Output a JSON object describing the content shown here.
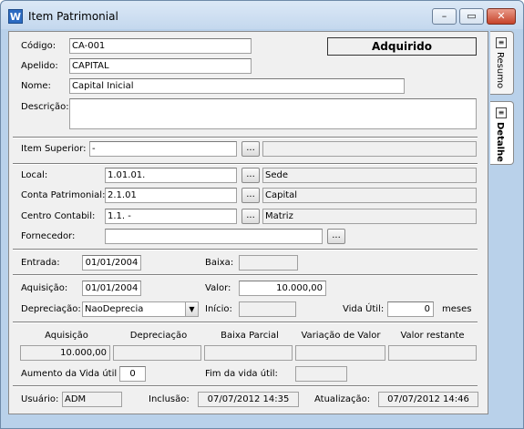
{
  "window": {
    "title": "Item Patrimonial",
    "app_icon": "W"
  },
  "status": "Adquirido",
  "tabs": [
    {
      "label": "Resumo"
    },
    {
      "label": "Detalhe"
    }
  ],
  "labels": {
    "codigo": "Código:",
    "apelido": "Apelido:",
    "nome": "Nome:",
    "descricao": "Descrição:",
    "item_superior": "Item Superior:",
    "local": "Local:",
    "conta": "Conta Patrimonial:",
    "centro": "Centro Contabil:",
    "fornecedor": "Fornecedor:",
    "entrada": "Entrada:",
    "baixa": "Baixa:",
    "aquisicao": "Aquisição:",
    "valor": "Valor:",
    "depreciacao": "Depreciação:",
    "inicio": "Início:",
    "vida_util": "Vida Útil:",
    "meses": "meses",
    "aumento": "Aumento da Vida útil :",
    "fim_vida": "Fim da vida útil:",
    "usuario": "Usuário:",
    "inclusao": "Inclusão:",
    "atualizacao": "Atualização:"
  },
  "fields": {
    "codigo": "CA-001",
    "apelido": "CAPITAL",
    "nome": "Capital Inicial",
    "descricao": "",
    "item_superior": "-",
    "item_superior_desc": "",
    "local": "1.01.01.",
    "local_desc": "Sede",
    "conta": "2.1.01",
    "conta_desc": "Capital",
    "centro": "1.1.  -",
    "centro_desc": "Matriz",
    "fornecedor": "",
    "fornecedor_desc": "",
    "entrada": "01/01/2004",
    "baixa": "",
    "aquisicao": "01/01/2004",
    "valor": "10.000,00",
    "depreciacao": "NaoDeprecia",
    "inicio": "",
    "vida_util": "0",
    "aumento": "0",
    "fim_vida": "",
    "usuario": "ADM",
    "inclusao": "07/07/2012 14:35",
    "atualizacao": "07/07/2012 14:46"
  },
  "summary_headers": [
    "Aquisição",
    "Depreciação",
    "Baixa Parcial",
    "Variação de Valor",
    "Valor restante"
  ],
  "summary_values": [
    "10.000,00",
    "",
    "",
    "",
    ""
  ],
  "button_dots": "...",
  "select_arrow": "▼"
}
